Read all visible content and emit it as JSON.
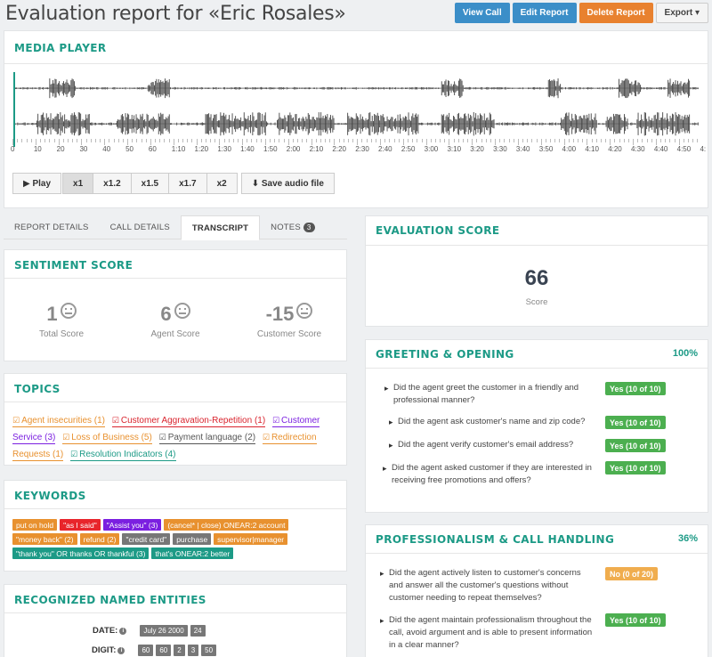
{
  "header": {
    "title": "Evaluation report for «Eric Rosales»",
    "buttons": {
      "view_call": "View Call",
      "edit_report": "Edit Report",
      "delete_report": "Delete Report",
      "export": "Export ▾"
    }
  },
  "media_player": {
    "title": "MEDIA PLAYER",
    "ticks": [
      "0",
      "10",
      "20",
      "30",
      "40",
      "50",
      "60",
      "1:10",
      "1:20",
      "1:30",
      "1:40",
      "1:50",
      "2:00",
      "2:10",
      "2:20",
      "2:30",
      "2:40",
      "2:50",
      "3:00",
      "3:10",
      "3:20",
      "3:30",
      "3:40",
      "3:50",
      "4:00",
      "4:10",
      "4:20",
      "4:30",
      "4:40",
      "4:50",
      "4:"
    ],
    "controls": {
      "play": "▶ Play",
      "x1": "x1",
      "x12": "x1.2",
      "x15": "x1.5",
      "x17": "x1.7",
      "x2": "x2",
      "save": "⬇ Save audio file"
    }
  },
  "tabs": {
    "report_details": "REPORT DETAILS",
    "call_details": "CALL DETAILS",
    "transcript": "TRANSCRIPT",
    "notes": "NOTES",
    "notes_count": "3"
  },
  "sentiment": {
    "title": "SENTIMENT SCORE",
    "total": {
      "value": "1",
      "label": "Total Score"
    },
    "agent": {
      "value": "6",
      "label": "Agent Score"
    },
    "customer": {
      "value": "-15",
      "label": "Customer Score"
    }
  },
  "topics": {
    "title": "TOPICS",
    "items": [
      {
        "label": "Agent insecurities (1)",
        "color": "#e8912f"
      },
      {
        "label": "Customer Aggravation-Repetition (1)",
        "color": "#d9232d"
      },
      {
        "label": "Customer Service (3)",
        "color": "#7b1fe0"
      },
      {
        "label": "Loss of Business (5)",
        "color": "#e8912f"
      },
      {
        "label": "Payment language (2)",
        "color": "#555555"
      },
      {
        "label": "Redirection Requests (1)",
        "color": "#e8912f"
      },
      {
        "label": "Resolution Indicators (4)",
        "color": "#1c9a86"
      }
    ]
  },
  "keywords": {
    "title": "KEYWORDS",
    "items": [
      {
        "label": "put on hold",
        "color": "#e8912f"
      },
      {
        "label": "\"as I said\"",
        "color": "#e8252b"
      },
      {
        "label": "\"Assist you\" (3)",
        "color": "#7b1fe0"
      },
      {
        "label": "(cancel* | close) ONEAR:2 account",
        "color": "#e8912f"
      },
      {
        "label": "\"money back\" (2)",
        "color": "#e8912f"
      },
      {
        "label": "refund (2)",
        "color": "#e8912f"
      },
      {
        "label": "\"credit card\"",
        "color": "#777777"
      },
      {
        "label": "purchase",
        "color": "#777777"
      },
      {
        "label": "supervisor|manager",
        "color": "#e8912f"
      },
      {
        "label": "\"thank you\" OR thanks OR thankful (3)",
        "color": "#1c9a86"
      },
      {
        "label": "that's ONEAR:2 better",
        "color": "#1c9a86"
      }
    ]
  },
  "entities": {
    "title": "RECOGNIZED NAMED ENTITIES",
    "date_label": "DATE:",
    "date_values": [
      "July 26 2000",
      "24"
    ],
    "digit_label": "DIGIT:",
    "digit_values": [
      "60",
      "60",
      "2",
      "3",
      "50"
    ]
  },
  "evaluation": {
    "title": "EVALUATION SCORE",
    "score": "66",
    "score_label": "Score"
  },
  "greeting": {
    "title": "GREETING & OPENING",
    "percent": "100%",
    "questions": [
      {
        "text": "Did the agent greet the customer in a friendly and professional manner?",
        "answer": "Yes (10 of 10)"
      },
      {
        "text": "Did the agent ask customer's name and zip code?",
        "answer": "Yes (10 of 10)"
      },
      {
        "text": "Did the agent verify customer's email address?",
        "answer": "Yes (10 of 10)"
      },
      {
        "text": "Did the agent asked customer if they are interested in receiving free promotions and offers?",
        "answer": "Yes (10 of 10)"
      }
    ]
  },
  "professionalism": {
    "title": "PROFESSIONALISM & CALL HANDLING",
    "percent": "36%",
    "questions": [
      {
        "text": "Did the agent actively listen to customer's concerns and answer all the customer's questions without customer needing to repeat themselves?",
        "answer": "No (0 of 20)"
      },
      {
        "text": "Did the agent maintain professionalism throughout the call, avoid argument and is able to present information in a clear manner?",
        "answer": "Yes (10 of 10)"
      }
    ]
  },
  "colors": {
    "accent": "#1c9a86",
    "yes": "#4caf50",
    "no": "#f0ad4e",
    "blue": "#3b8ec8",
    "orange": "#e8812f"
  }
}
